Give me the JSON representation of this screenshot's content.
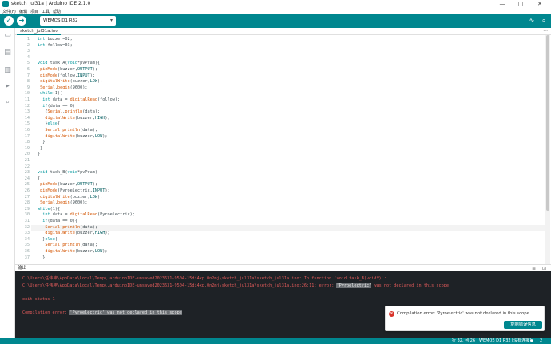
{
  "window": {
    "title": "sketch_jul31a | Arduino IDE 2.1.0",
    "minimize": "—",
    "maximize": "□",
    "close": "✕"
  },
  "menu": [
    "文件(F)",
    "编辑",
    "项目",
    "工具",
    "帮助"
  ],
  "toolbar": {
    "verify_icon": "checkmark-icon",
    "upload_icon": "arrow-right-icon",
    "board": "WEMOS D1 R32",
    "serial_plotter_icon": "pulse-icon",
    "serial_monitor_icon": "search-icon"
  },
  "sidebar": [
    "folder-icon",
    "boards-icon",
    "library-icon",
    "debug-icon",
    "search-icon"
  ],
  "tabs": [
    {
      "label": "sketch_jul31a.ino"
    }
  ],
  "tab_more": "···",
  "editor": {
    "lines": [
      {
        "n": "1",
        "t": "int buzzer=02;"
      },
      {
        "n": "2",
        "t": "int follow=03;"
      },
      {
        "n": "3",
        "t": ""
      },
      {
        "n": "4",
        "t": ""
      },
      {
        "n": "5",
        "t": "void task_A(void*pvPram){"
      },
      {
        "n": "6",
        "t": " pinMode(buzzer,OUTPUT);"
      },
      {
        "n": "7",
        "t": " pinMode(follow,INPUT);"
      },
      {
        "n": "8",
        "t": " digitalWrite(buzzer,LOW);"
      },
      {
        "n": "9",
        "t": " Serial.begin(9600);"
      },
      {
        "n": "10",
        "t": " while(1){"
      },
      {
        "n": "11",
        "t": "  int data = digitalRead(follow);"
      },
      {
        "n": "12",
        "t": "  if(data == 0)"
      },
      {
        "n": "13",
        "t": "   {Serial.println(data);"
      },
      {
        "n": "14",
        "t": "   digitalWrite(buzzer,HIGH);"
      },
      {
        "n": "15",
        "t": "   }else{"
      },
      {
        "n": "16",
        "t": "   Serial.println(data);"
      },
      {
        "n": "17",
        "t": "   digitalWrite(buzzer,LOW);"
      },
      {
        "n": "18",
        "t": "  }"
      },
      {
        "n": "19",
        "t": " }"
      },
      {
        "n": "20",
        "t": "}"
      },
      {
        "n": "21",
        "t": ""
      },
      {
        "n": "22",
        "t": ""
      },
      {
        "n": "23",
        "t": "void task_B(void*pvPram)"
      },
      {
        "n": "24",
        "t": "{"
      },
      {
        "n": "25",
        "t": " pinMode(buzzer,OUTPUT);"
      },
      {
        "n": "26",
        "t": " pinMode(Pyroelectric,INPUT);"
      },
      {
        "n": "27",
        "t": " digitalWrite(buzzer,LOW);"
      },
      {
        "n": "28",
        "t": " Serial.begin(9600);"
      },
      {
        "n": "29",
        "t": "while(1){"
      },
      {
        "n": "30",
        "t": "  int data = digitalRead(Pyroelectric);"
      },
      {
        "n": "31",
        "t": "  if(data == 0){"
      },
      {
        "n": "32",
        "t": "   Serial.println(data);"
      },
      {
        "n": "33",
        "t": "   digitalWrite(buzzer,HIGH);"
      },
      {
        "n": "34",
        "t": "  }else{"
      },
      {
        "n": "35",
        "t": "   Serial.println(data);"
      },
      {
        "n": "36",
        "t": "   digitalWrite(buzzer,LOW);"
      },
      {
        "n": "37",
        "t": "  }"
      }
    ]
  },
  "output": {
    "header": "输出",
    "lines": [
      {
        "pre": "C:\\Users\\任伟坤\\AppData\\Local\\Temp\\.arduinoIDE-unsaved2023631-9504-15di4xp.0n2mj\\sketch_jul31a\\sketch_jul31a.ino: In function 'void task_B(void*)':",
        "hl": "",
        "post": ""
      },
      {
        "pre": "C:\\Users\\任伟坤\\AppData\\Local\\Temp\\.arduinoIDE-unsaved2023631-9504-15di4xp.0n2mj\\sketch_jul31a\\sketch_jul31a.ino:26:11: error: ",
        "hl": "'Pyroelectric'",
        "post": " was not declared in this scope"
      },
      {
        "pre": "",
        "hl": "",
        "post": ""
      },
      {
        "pre": "exit status 1",
        "hl": "",
        "post": ""
      },
      {
        "pre": "",
        "hl": "",
        "post": ""
      },
      {
        "pre": "Compilation error: ",
        "hl": "'Pyroelectric' was not declared in this scope",
        "post": ""
      }
    ]
  },
  "toast": {
    "message": "Compilation error: 'Pyroelectric' was not declared in this scope",
    "button": "复制错误信息"
  },
  "status": {
    "position": "行 32, 列 26",
    "board": "WEMOS D1 R32 [没有连接]",
    "bell": "🔔",
    "count": "2"
  },
  "colors": {
    "teal": "#00878f",
    "output_bg": "#1e2226",
    "error": "#e05a5a"
  }
}
